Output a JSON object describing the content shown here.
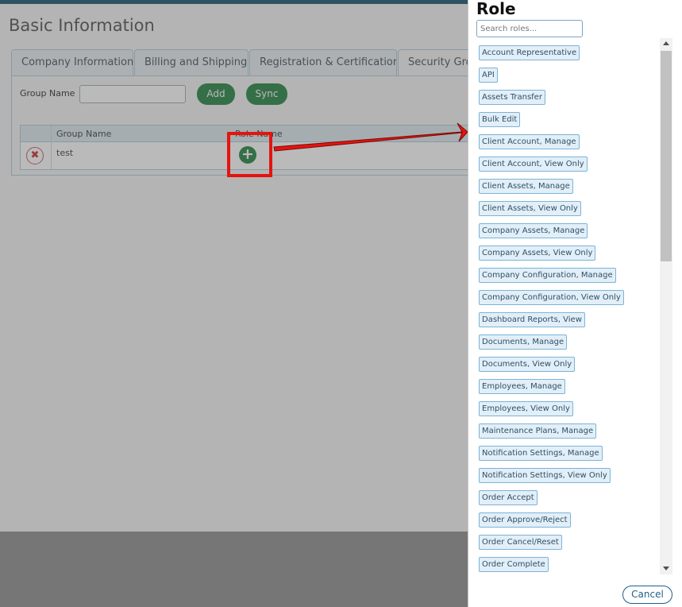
{
  "page": {
    "title": "Basic Information",
    "tabs": [
      {
        "label": "Company Information"
      },
      {
        "label": "Billing and Shipping"
      },
      {
        "label": "Registration & Certification"
      },
      {
        "label": "Security Groups"
      }
    ],
    "group_name_label": "Group Name",
    "group_name_value": "",
    "add_label": "Add",
    "sync_label": "Sync",
    "grid": {
      "columns": [
        "",
        "Group Name",
        "Role Name"
      ],
      "rows": [
        {
          "group_name": "test"
        }
      ]
    }
  },
  "dialog": {
    "title": "Role",
    "search_placeholder": "Search roles...",
    "roles": [
      "Account Representative",
      "API",
      "Assets Transfer",
      "Bulk Edit",
      "Client Account, Manage",
      "Client Account, View Only",
      "Client Assets, Manage",
      "Client Assets, View Only",
      "Company Assets, Manage",
      "Company Assets, View Only",
      "Company Configuration, Manage",
      "Company Configuration, View Only",
      "Dashboard Reports, View",
      "Documents, Manage",
      "Documents, View Only",
      "Employees, Manage",
      "Employees, View Only",
      "Maintenance Plans, Manage",
      "Notification Settings, Manage",
      "Notification Settings, View Only",
      "Order Accept",
      "Order Approve/Reject",
      "Order Cancel/Reset",
      "Order Complete"
    ],
    "cancel_label": "Cancel"
  },
  "colors": {
    "accent_green": "#1b7f3a",
    "annotation_red": "#e4140f",
    "chip_border": "#7db3d6",
    "header_bar": "#0e4d6a"
  }
}
